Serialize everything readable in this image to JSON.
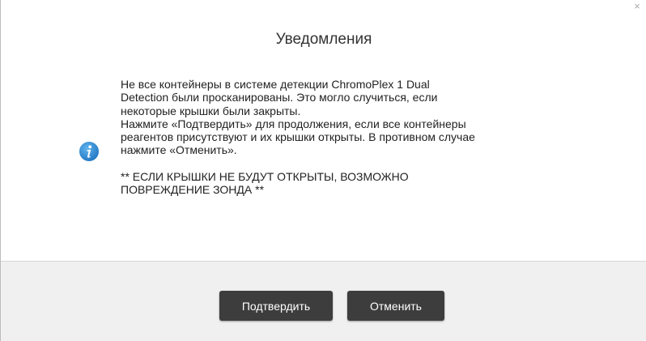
{
  "dialog": {
    "title": "Уведомления",
    "close_symbol": "×",
    "icon": "info-icon",
    "message": {
      "line1": "Не все контейнеры в системе детекции ChromoPlex 1 Dual",
      "line2": "Detection были просканированы. Это могло случиться, если",
      "line3": "некоторые крышки были закрыты.",
      "line4": "Нажмите «Подтвердить» для продолжения, если все контейнеры",
      "line5": "реагентов присутствуют и их крышки открыты. В противном случае",
      "line6": "нажмите «Отменить».",
      "warning1": "** ЕСЛИ КРЫШКИ НЕ БУДУТ ОТКРЫТЫ, ВОЗМОЖНО",
      "warning2": "ПОВРЕЖДЕНИЕ ЗОНДА **"
    },
    "buttons": {
      "confirm_label": "Подтвердить",
      "cancel_label": "Отменить"
    }
  },
  "colors": {
    "info_icon": "#2e8bd3",
    "button_bg": "#3d3d3d",
    "footer_bg": "#f0f0f0"
  }
}
